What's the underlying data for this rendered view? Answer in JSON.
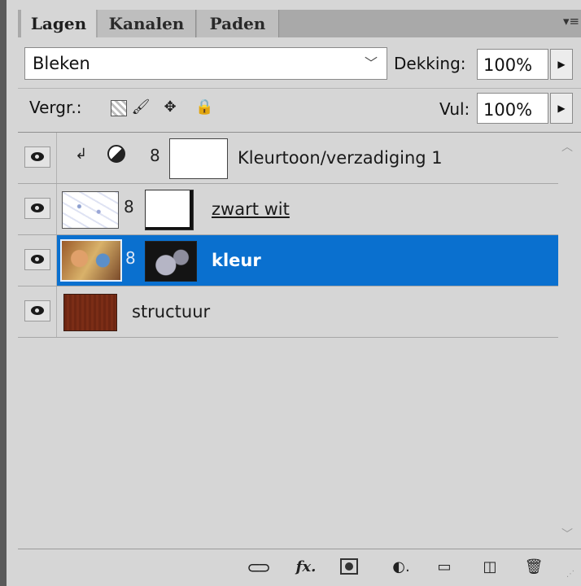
{
  "tabs": [
    {
      "label": "Lagen",
      "active": true
    },
    {
      "label": "Kanalen",
      "active": false
    },
    {
      "label": "Paden",
      "active": false
    }
  ],
  "toolbar": {
    "blend_mode": "Bleken",
    "opacity_label": "Dekking:",
    "opacity_value": "100%",
    "lock_label": "Vergr.:",
    "fill_label": "Vul:",
    "fill_value": "100%"
  },
  "layers": [
    {
      "name": "Kleurtoon/verzadiging 1",
      "visible": true,
      "type": "adjustment",
      "clipped": true
    },
    {
      "name": "zwart wit",
      "visible": true,
      "type": "pixel-with-mask"
    },
    {
      "name": "kleur",
      "visible": true,
      "type": "pixel-with-mask",
      "selected": true
    },
    {
      "name": "structuur",
      "visible": true,
      "type": "pixel"
    }
  ],
  "footer_icons": [
    "link-icon",
    "fx-icon",
    "layer-mask-icon",
    "adjustment-layer-icon",
    "folder-icon",
    "new-layer-icon",
    "trash-icon"
  ],
  "colors": {
    "selection": "#0a70cf",
    "panel": "#d6d6d6",
    "tab_bar": "#a9a9a9"
  }
}
